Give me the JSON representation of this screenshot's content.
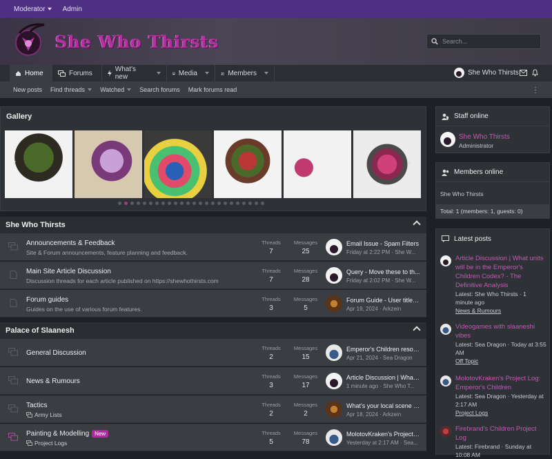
{
  "topbar": {
    "moderator": "Moderator",
    "admin": "Admin"
  },
  "header": {
    "site_name": "She Who Thirsts",
    "search_placeholder": "Search..."
  },
  "nav": {
    "tabs": [
      {
        "label": "Home"
      },
      {
        "label": "Forums"
      },
      {
        "label": "What's new"
      },
      {
        "label": "Media"
      },
      {
        "label": "Members"
      }
    ],
    "user": "She Who Thirsts"
  },
  "subnav": [
    "New posts",
    "Find threads",
    "Watched",
    "Search forums",
    "Mark forums read"
  ],
  "gallery": {
    "title": "Gallery",
    "dot_count": 24,
    "active_dot": 1
  },
  "categories": [
    {
      "title": "She Who Thirsts",
      "forums": [
        {
          "title": "Announcements & Feedback",
          "desc": "Site & Forum announcements, feature planning and feedback.",
          "threads_label": "Threads",
          "threads": "7",
          "messages_label": "Messages",
          "messages": "25",
          "last_title": "Email Issue - Spam Filters",
          "last_meta": "Friday at 2:22 PM · She W..."
        },
        {
          "title": "Main Site Article Discussion",
          "desc": "Discussion threads for each article published on https://shewhothirsts.com",
          "threads_label": "Threads",
          "threads": "7",
          "messages_label": "Messages",
          "messages": "28",
          "last_title": "Query - Move these to th...",
          "last_meta": "Friday at 2:02 PM · She W..."
        },
        {
          "title": "Forum guides",
          "desc": "Guides on the use of various forum features.",
          "threads_label": "Threads",
          "threads": "3",
          "messages_label": "Messages",
          "messages": "5",
          "last_title": "Forum Guide - User titles ...",
          "last_meta": "Apr 19, 2024 · Arkzein"
        }
      ]
    },
    {
      "title": "Palace of Slaanesh",
      "forums": [
        {
          "title": "General Discussion",
          "threads_label": "Threads",
          "threads": "2",
          "messages_label": "Messages",
          "messages": "15",
          "last_title": "Emperor's Children resour...",
          "last_meta": "Apr 21, 2024 · Sea Dragon"
        },
        {
          "title": "News & Rumours",
          "threads_label": "Threads",
          "threads": "3",
          "messages_label": "Messages",
          "messages": "17",
          "last_title": "Article Discussion | What ...",
          "last_meta": "1 minute ago · She Who T..."
        },
        {
          "title": "Tactics",
          "sub": "Army Lists",
          "threads_label": "Threads",
          "threads": "2",
          "messages_label": "Messages",
          "messages": "2",
          "last_title": "What's your local scene / ...",
          "last_meta": "Apr 18, 2024 · Arkzein"
        },
        {
          "title": "Painting & Modelling",
          "badge": "New",
          "sub": "Project Logs",
          "threads_label": "Threads",
          "threads": "5",
          "messages_label": "Messages",
          "messages": "78",
          "last_title": "MolotovKraken's Project L...",
          "last_meta": "Yesterday at 2:17 AM · Sea..."
        }
      ]
    }
  ],
  "staff_online": {
    "title": "Staff online",
    "name": "She Who Thirsts",
    "role": "Administrator"
  },
  "members_online": {
    "title": "Members online",
    "list": "She Who Thirsts",
    "total": "Total: 1 (members: 1, guests: 0)"
  },
  "latest_posts": {
    "title": "Latest posts",
    "items": [
      {
        "lines": [
          "Article Discussion | What units",
          "will be in the Emperor's",
          "Children Codex? - The",
          "Definitive Analysis"
        ],
        "meta": [
          "Latest: She Who Thirsts · 1",
          "minute ago"
        ],
        "forum": "News & Rumours"
      },
      {
        "lines": [
          "Videogames with slaaneshi",
          "vibes"
        ],
        "meta": [
          "Latest: Sea Dragon · Today at 3:55",
          "AM"
        ],
        "forum": "Off Topic"
      },
      {
        "lines": [
          "MolotovKraken's Project Log:",
          "Emperor's Children"
        ],
        "meta": [
          "Latest: Sea Dragon · Yesterday at",
          "2:17 AM"
        ],
        "forum": "Project Logs"
      },
      {
        "lines": [
          "Firebrand's Children Project",
          "Log"
        ],
        "meta": [
          "Latest: Firebrand · Sunday at",
          "10:08 AM"
        ],
        "forum": ""
      }
    ]
  },
  "colors": {
    "brand": "#4f2f82",
    "accent": "#c25bb4",
    "badge_new": "#b12ba0"
  }
}
